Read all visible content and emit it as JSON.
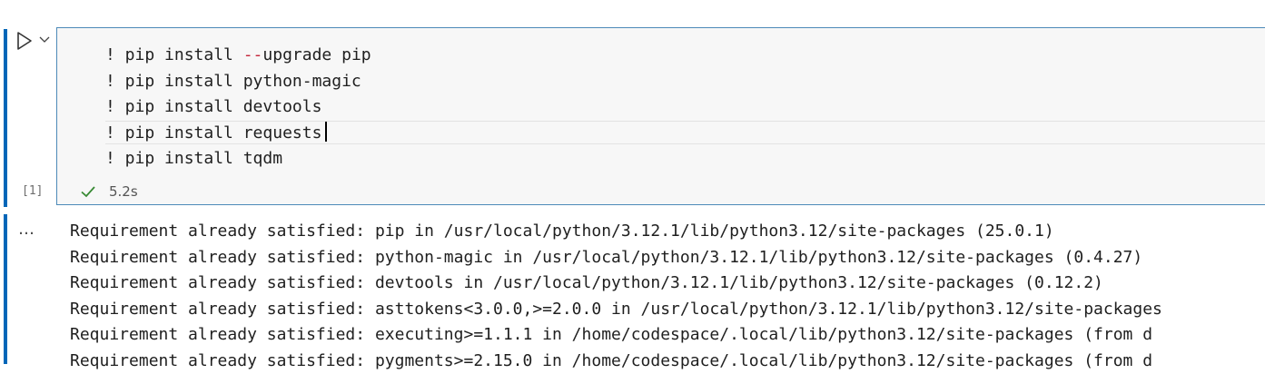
{
  "cell": {
    "execution_count": "[1]",
    "duration": "5.2s",
    "code_lines": [
      {
        "prefix": "! pip install ",
        "keyword": "--",
        "rest": "upgrade pip"
      },
      {
        "prefix": "! pip install python-magic",
        "keyword": "",
        "rest": ""
      },
      {
        "prefix": "! pip install devtools",
        "keyword": "",
        "rest": ""
      },
      {
        "prefix": "! pip install requests",
        "keyword": "",
        "rest": ""
      },
      {
        "prefix": "! pip install tqdm",
        "keyword": "",
        "rest": ""
      }
    ]
  },
  "output": {
    "more_label": "…",
    "lines": [
      "Requirement already satisfied: pip in /usr/local/python/3.12.1/lib/python3.12/site-packages (25.0.1)",
      "Requirement already satisfied: python-magic in /usr/local/python/3.12.1/lib/python3.12/site-packages (0.4.27)",
      "Requirement already satisfied: devtools in /usr/local/python/3.12.1/lib/python3.12/site-packages (0.12.2)",
      "Requirement already satisfied: asttokens<3.0.0,>=2.0.0 in /usr/local/python/3.12.1/lib/python3.12/site-packages",
      "Requirement already satisfied: executing>=1.1.1 in /home/codespace/.local/lib/python3.12/site-packages (from d",
      "Requirement already satisfied: pygments>=2.15.0 in /home/codespace/.local/lib/python3.12/site-packages (from d"
    ]
  },
  "colors": {
    "accent": "#0066b8",
    "success": "#388a34",
    "keyword": "#c4273c"
  }
}
